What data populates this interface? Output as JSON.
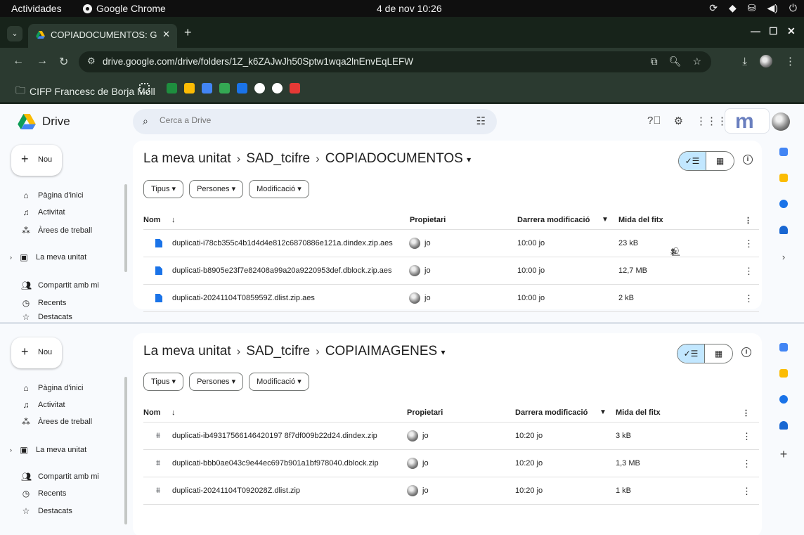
{
  "os": {
    "activities": "Actividades",
    "app_name": "Google Chrome",
    "clock": "4 de nov  10:26",
    "tray": [
      "⟳",
      "◆",
      "⛁",
      "◀)",
      "⏻"
    ]
  },
  "chrome": {
    "tab_title": "COPIADOCUMENTOS: G",
    "tab_close": "✕",
    "new_tab": "+",
    "url": "drive.google.com/drive/folders/1Z_k6ZAJwJh50Sptw1wqa2lnEnvEqLEFW",
    "bookmark_folder": "CIFP Francesc de Borja Moll",
    "bookmark_colors": [
      "#1e8e3e",
      "#fbbc04",
      "#4285f4",
      "#34a853",
      "#1a73e8",
      "#ffffff",
      "#ffffff",
      "#e53935"
    ]
  },
  "drive": {
    "app_name": "Drive",
    "search_placeholder": "Cerca a Drive",
    "brand_letter": "m",
    "new_label": "Nou",
    "nav": {
      "home": "Pàgina d'inici",
      "activity": "Activitat",
      "workspaces": "Àrees de treball",
      "my_drive": "La meva unitat",
      "shared": "Compartit amb mi",
      "recent": "Recents",
      "starred": "Destacats"
    },
    "breadcrumb_root": "La meva unitat",
    "breadcrumb_parent": "SAD_tcifre",
    "filters": {
      "type": "Tipus",
      "people": "Persones",
      "modified": "Modificació"
    },
    "columns": {
      "name": "Nom",
      "owner": "Propietari",
      "modified": "Darrera modificació",
      "size": "Mida del fitx"
    }
  },
  "panel1": {
    "folder": "COPIADOCUMENTOS",
    "rows": [
      {
        "name": "duplicati-i78cb355c4b1d4d4e812c6870886e121a.dindex.zip.aes",
        "owner": "jo",
        "modified": "10:00 jo",
        "size": "23 kB"
      },
      {
        "name": "duplicati-b8905e23f7e82408a99a20a9220953def.dblock.zip.aes",
        "owner": "jo",
        "modified": "10:00 jo",
        "size": "12,7 MB"
      },
      {
        "name": "duplicati-20241104T085959Z.dlist.zip.aes",
        "owner": "jo",
        "modified": "10:00 jo",
        "size": "2 kB"
      }
    ]
  },
  "panel2": {
    "folder": "COPIAIMAGENES",
    "rows": [
      {
        "name": "duplicati-ib49317566146420197 8f7df009b22d24.dindex.zip",
        "owner": "jo",
        "modified": "10:20 jo",
        "size": "3 kB"
      },
      {
        "name": "duplicati-bbb0ae043c9e44ec697b901a1bf978040.dblock.zip",
        "owner": "jo",
        "modified": "10:20 jo",
        "size": "1,3 MB"
      },
      {
        "name": "duplicati-20241104T092028Z.dlist.zip",
        "owner": "jo",
        "modified": "10:20 jo",
        "size": "1 kB"
      }
    ]
  }
}
